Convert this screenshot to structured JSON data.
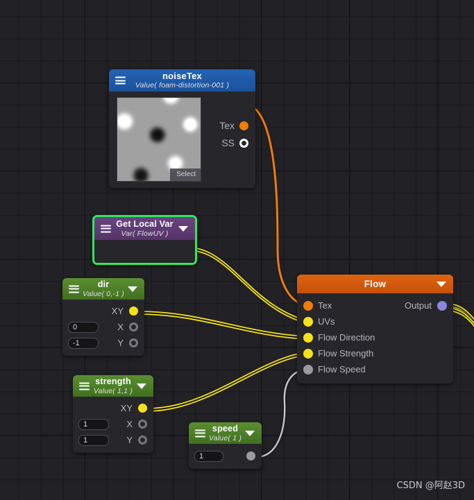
{
  "app": {
    "watermark": "CSDN @阿赵3D"
  },
  "colors": {
    "canvas_bg": "#212126",
    "grid_minor": "#19191d",
    "grid_major": "#141417",
    "node_body": "#26262b",
    "header_blue": "#1d5cab",
    "header_purple": "#5d3a73",
    "header_green": "#4a7c28",
    "header_orange": "#d4590a",
    "selection_green": "#2ee85c",
    "port_orange": "#f07c0a",
    "port_yellow": "#f4e11a",
    "port_purple": "#8a86e0",
    "port_gray": "#9a9a9f",
    "wire_yellow": "#f4e11a",
    "wire_orange": "#f07c0a",
    "wire_gray": "#c8c8c8"
  },
  "nodes": {
    "noisetex": {
      "title": "noiseTex",
      "subtitle": "Value( foam-distortion-001 )",
      "menu_icon": "hamburger-icon",
      "preview_button": "Select",
      "outputs": [
        {
          "label": "Tex",
          "port": "orange-filled"
        },
        {
          "label": "SS",
          "port": "white-ring"
        }
      ]
    },
    "getlocalvar": {
      "title": "Get Local Var",
      "subtitle": "Var( FlowUV )",
      "menu_icon": "hamburger-icon",
      "caret_icon": "chevron-down-icon",
      "selected": "true",
      "outputs": [
        {
          "label": "",
          "port": "purple-filled"
        }
      ]
    },
    "dir": {
      "title": "dir",
      "subtitle": "Value( 0,-1 )",
      "menu_icon": "hamburger-icon",
      "caret_icon": "chevron-down-icon",
      "rows": [
        {
          "value": "",
          "label": "XY",
          "port": "yellow-filled"
        },
        {
          "value": "0",
          "label": "X",
          "port": "gray-ring"
        },
        {
          "value": "-1",
          "label": "Y",
          "port": "gray-ring"
        }
      ]
    },
    "strength": {
      "title": "strength",
      "subtitle": "Value( 1,1 )",
      "menu_icon": "hamburger-icon",
      "caret_icon": "chevron-down-icon",
      "rows": [
        {
          "value": "",
          "label": "XY",
          "port": "yellow-filled"
        },
        {
          "value": "1",
          "label": "X",
          "port": "gray-ring"
        },
        {
          "value": "1",
          "label": "Y",
          "port": "gray-ring"
        }
      ]
    },
    "speed": {
      "title": "speed",
      "subtitle": "Value( 1 )",
      "menu_icon": "hamburger-icon",
      "caret_icon": "chevron-down-icon",
      "rows": [
        {
          "value": "1",
          "label": "",
          "port": "gray-filled"
        }
      ]
    },
    "flow": {
      "title": "Flow",
      "caret_icon": "chevron-down-icon",
      "inputs": [
        {
          "label": "Tex",
          "port": "orange-filled"
        },
        {
          "label": "UVs",
          "port": "yellow-filled"
        },
        {
          "label": "Flow Direction",
          "port": "yellow-filled"
        },
        {
          "label": "Flow Strength",
          "port": "yellow-filled"
        },
        {
          "label": "Flow Speed",
          "port": "gray-filled"
        }
      ],
      "output": {
        "label": "Output",
        "port": "purple-filled"
      }
    }
  },
  "connections": [
    {
      "from": "noisetex.Tex",
      "to": "flow.Tex",
      "color": "orange"
    },
    {
      "from": "getlocalvar.out",
      "to": "flow.UVs",
      "color": "yellow"
    },
    {
      "from": "dir.XY",
      "to": "flow.Flow Direction",
      "color": "yellow"
    },
    {
      "from": "strength.XY",
      "to": "flow.Flow Strength",
      "color": "yellow"
    },
    {
      "from": "speed.out",
      "to": "flow.Flow Speed",
      "color": "gray"
    },
    {
      "from": "flow.Output",
      "to": "offscreen",
      "color": "yellow"
    }
  ]
}
